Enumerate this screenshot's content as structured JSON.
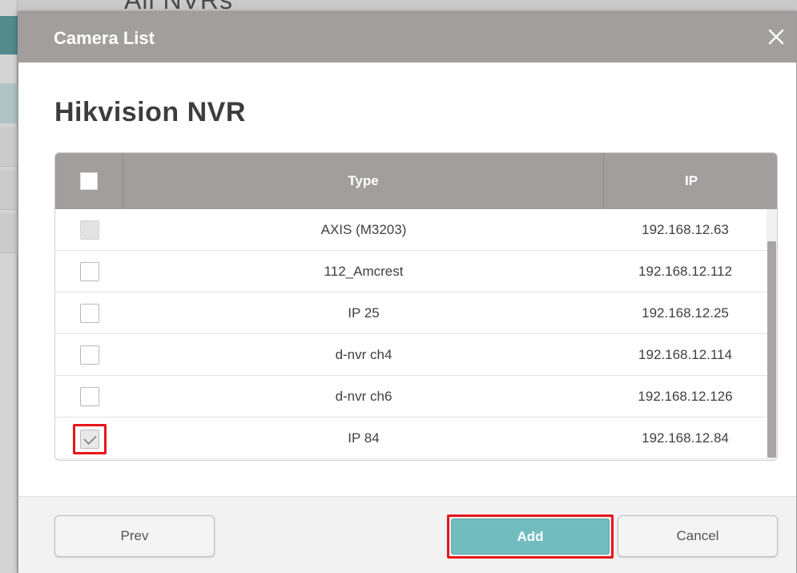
{
  "background": {
    "heading": "All NVRs"
  },
  "dialog": {
    "title": "Camera List",
    "close_icon": "close-icon",
    "device_name": "Hikvision NVR"
  },
  "table": {
    "columns": [
      "",
      "Type",
      "IP"
    ],
    "rows": [
      {
        "type": "AXIS (M3203)",
        "ip": "192.168.12.63",
        "state": "disabled"
      },
      {
        "type": "112_Amcrest",
        "ip": "192.168.12.112",
        "state": "unchecked"
      },
      {
        "type": "IP 25",
        "ip": "192.168.12.25",
        "state": "unchecked"
      },
      {
        "type": "d-nvr ch4",
        "ip": "192.168.12.114",
        "state": "unchecked"
      },
      {
        "type": "d-nvr ch6",
        "ip": "192.168.12.126",
        "state": "unchecked"
      },
      {
        "type": "IP 84",
        "ip": "192.168.12.84",
        "state": "checked"
      }
    ]
  },
  "footer": {
    "prev_label": "Prev",
    "add_label": "Add",
    "cancel_label": "Cancel"
  },
  "colors": {
    "header_gray": "#a29e9e",
    "accent_teal": "#72bcc0",
    "highlight_red": "#e8141b"
  }
}
